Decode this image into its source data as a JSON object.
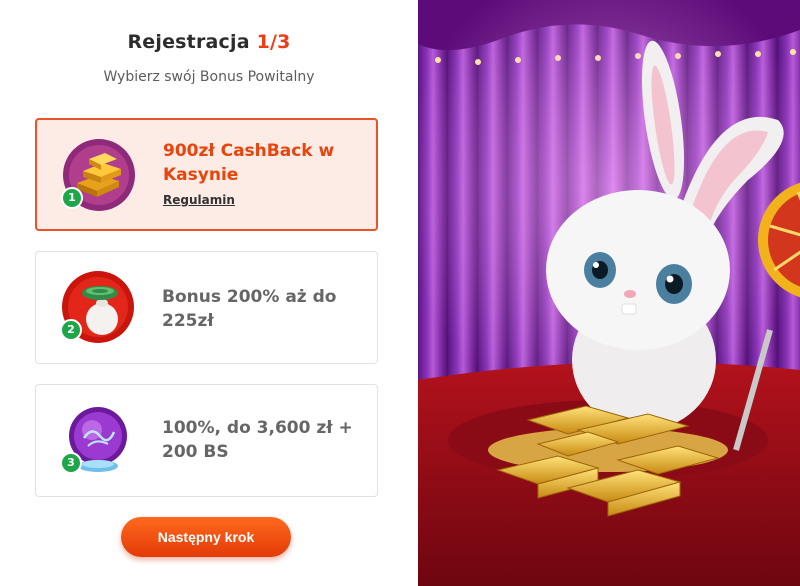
{
  "header": {
    "title": "Rejestracja",
    "step": "1/3",
    "subtitle": "Wybierz swój Bonus Powitalny"
  },
  "bonuses": [
    {
      "number": "1",
      "line1": "900zł CashBack w",
      "line2": "Kasynie",
      "terms": "Regulamin",
      "icon": "gold-bars-icon",
      "selected": true
    },
    {
      "number": "2",
      "line1": "Bonus 200% aż do",
      "line2": "225zł",
      "icon": "money-bag-icon",
      "selected": false
    },
    {
      "number": "3",
      "line1": "100%, do 3,600 zł +",
      "line2": "200 BS",
      "icon": "crystal-ball-icon",
      "selected": false
    }
  ],
  "actions": {
    "next": "Następny krok"
  },
  "colors": {
    "accent": "#e8532a",
    "button": "#f14f12",
    "badge": "#1fa64b",
    "selected_bg": "#fcece5"
  }
}
